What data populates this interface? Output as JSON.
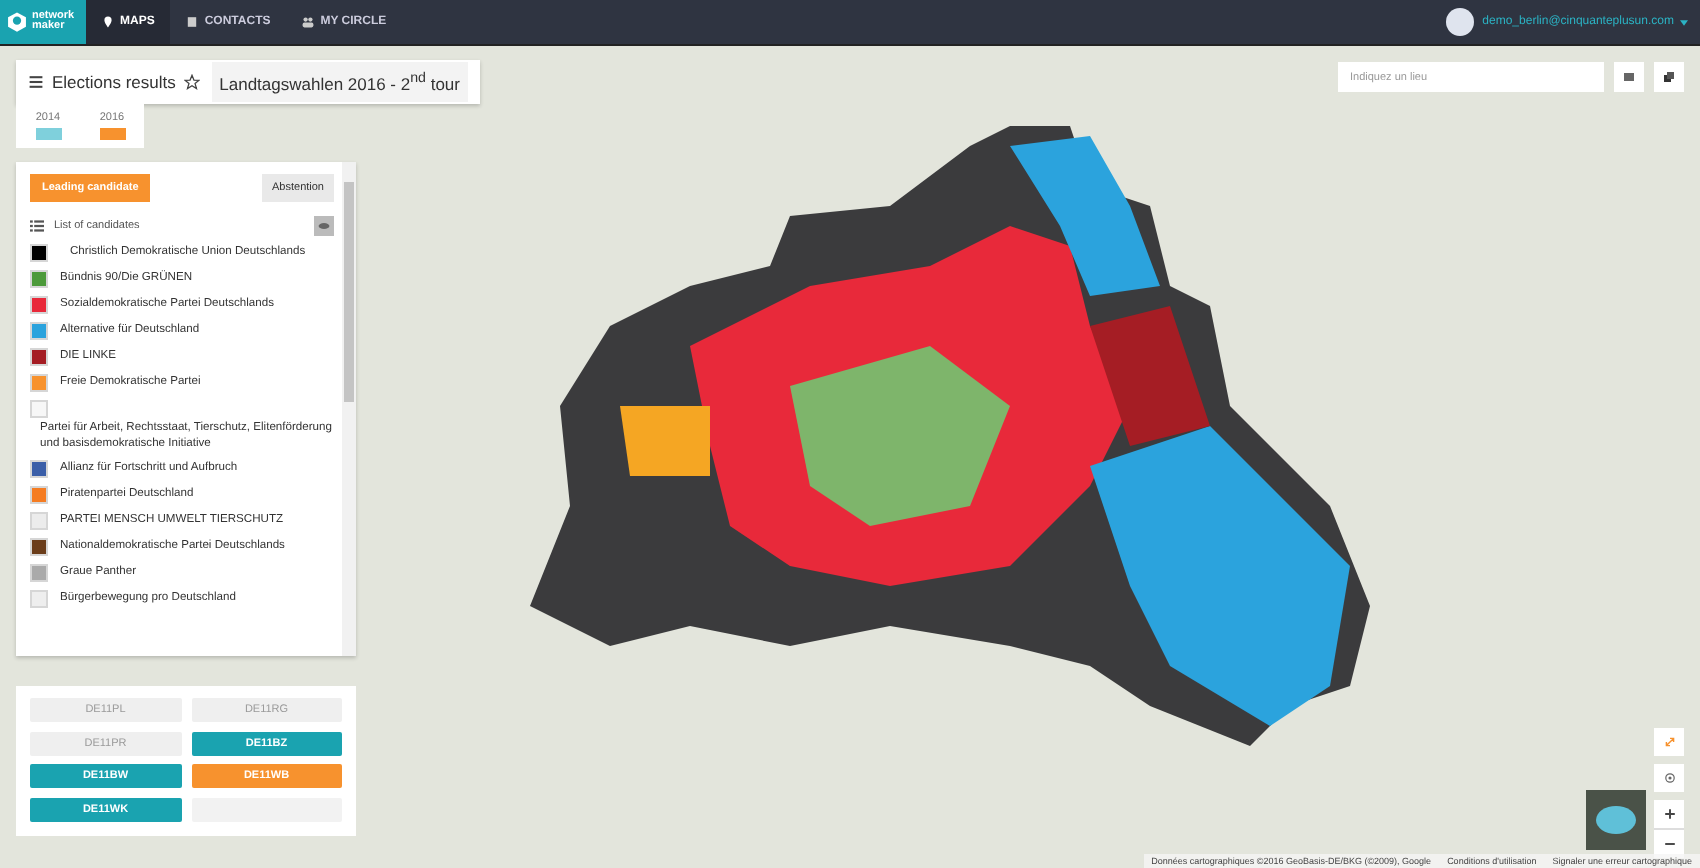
{
  "navbar": {
    "logo": [
      "network",
      "maker"
    ],
    "items": [
      {
        "label": "MAPS",
        "kind": "pin",
        "selected": true
      },
      {
        "label": "CONTACTS",
        "kind": "book",
        "selected": false
      },
      {
        "label": "MY CIRCLE",
        "kind": "people",
        "selected": false
      }
    ],
    "user": "demo_berlin@cinquanteplusun.com"
  },
  "title_bar": {
    "title": "Elections results",
    "subtitle": "Landtagswahlen 2016 - 2$^{nd}$ tour"
  },
  "years": [
    {
      "label": "2014",
      "color": "#7fd0dc"
    },
    {
      "label": "2016",
      "color": "#f7922e"
    }
  ],
  "modes": [
    {
      "label": "Leading candidate",
      "selected": true
    },
    {
      "label": "Abstention",
      "selected": false
    }
  ],
  "candidates": {
    "heading": "List of candidates",
    "items": [
      {
        "name": "Christlich Demokratische Union Deutschlands",
        "color": "#000000"
      },
      {
        "name": "Bündnis 90/Die GRÜNEN",
        "color": "#4c9a3a"
      },
      {
        "name": "Sozialdemokratische Partei Deutschlands",
        "color": "#e8293a"
      },
      {
        "name": "Alternative für Deutschland",
        "color": "#2ba3dd"
      },
      {
        "name": "DIE LINKE",
        "color": "#a51d24"
      },
      {
        "name": "Freie Demokratische Partei",
        "color": "#f7922e"
      },
      {
        "name": "Partei für Arbeit, Rechtsstaat, Tierschutz, Elitenförderung und basisdemokratische Initiative",
        "color": "#f7f7f7"
      },
      {
        "name": "Allianz für Fortschritt und Aufbruch",
        "color": "#3a5ea8"
      },
      {
        "name": "Piratenpartei Deutschland",
        "color": "#f57c22"
      },
      {
        "name": "PARTEI MENSCH UMWELT TIERSCHUTZ",
        "color": "#ececec"
      },
      {
        "name": "Nationaldemokratische Partei Deutschlands",
        "color": "#6b3d1a"
      },
      {
        "name": "Graue Panther",
        "color": "#aaaaaa"
      },
      {
        "name": "Bürgerbewegung pro Deutschland",
        "color": "#eeeeee"
      }
    ]
  },
  "districts": [
    {
      "label": "DE11PL",
      "kind": "inactive"
    },
    {
      "label": "DE11RG",
      "kind": "inactive"
    },
    {
      "label": "DE11PR",
      "kind": "inactive"
    },
    {
      "label": "DE11BZ",
      "kind": "active"
    },
    {
      "label": "DE11BW",
      "kind": "active"
    },
    {
      "label": "DE11WB",
      "kind": "highlight"
    },
    {
      "label": "DE11WK",
      "kind": "active"
    },
    {
      "kind": "empty"
    }
  ],
  "search": {
    "placeholder": "Indiquez un lieu"
  },
  "attribution": [
    "Données cartographiques ©2016 GeoBasis-DE/BKG (©2009), Google",
    "Conditions d'utilisation",
    "Signaler une erreur cartographique"
  ]
}
